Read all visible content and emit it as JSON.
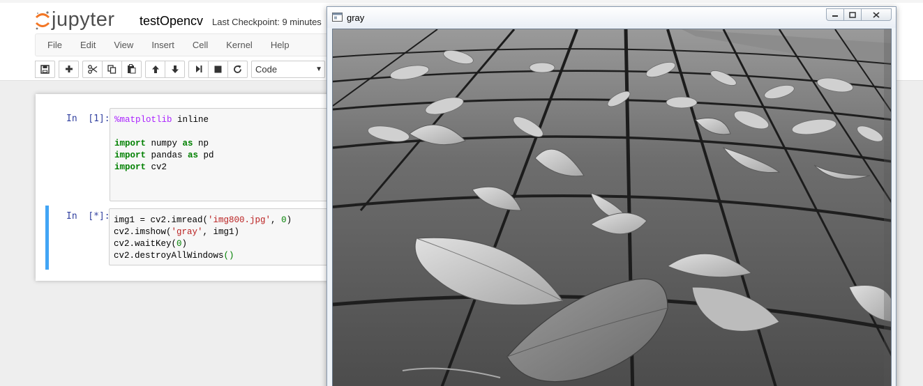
{
  "app": {
    "logo_text": "jupyter",
    "notebook_name": "testOpencv",
    "checkpoint": "Last Checkpoint: 9 minutes"
  },
  "menu": [
    "File",
    "Edit",
    "View",
    "Insert",
    "Cell",
    "Kernel",
    "Help"
  ],
  "toolbar": {
    "cell_type": "Code",
    "icons": [
      "save-icon",
      "plus-icon",
      "cut-icon",
      "copy-icon",
      "paste-icon",
      "arrow-up-icon",
      "arrow-down-icon",
      "run-step-icon",
      "stop-icon",
      "restart-icon"
    ]
  },
  "cells": [
    {
      "prompt": "In  [1]:",
      "lines": [
        [
          {
            "t": "%matplotlib",
            "c": "mg"
          },
          {
            "t": " inline",
            "c": ""
          }
        ],
        [],
        [
          {
            "t": "import",
            "c": "kw"
          },
          {
            "t": " numpy ",
            "c": ""
          },
          {
            "t": "as",
            "c": "kw"
          },
          {
            "t": " np",
            "c": ""
          }
        ],
        [
          {
            "t": "import",
            "c": "kw"
          },
          {
            "t": " pandas ",
            "c": ""
          },
          {
            "t": "as",
            "c": "kw"
          },
          {
            "t": " pd",
            "c": ""
          }
        ],
        [
          {
            "t": "import",
            "c": "kw"
          },
          {
            "t": " cv2",
            "c": ""
          }
        ]
      ]
    },
    {
      "prompt": "In  [*]:",
      "lines": [
        [
          {
            "t": "img1 = cv2.imread(",
            "c": ""
          },
          {
            "t": "'img800.jpg'",
            "c": "str"
          },
          {
            "t": ", ",
            "c": ""
          },
          {
            "t": "0",
            "c": "num"
          },
          {
            "t": ")",
            "c": ""
          }
        ],
        [
          {
            "t": "cv2.imshow(",
            "c": ""
          },
          {
            "t": "'gray'",
            "c": "str"
          },
          {
            "t": ", img1)",
            "c": ""
          }
        ],
        [
          {
            "t": "cv2.waitKey(",
            "c": ""
          },
          {
            "t": "0",
            "c": "num"
          },
          {
            "t": ")",
            "c": ""
          }
        ],
        [
          {
            "t": "cv2.destroyAllWindows",
            "c": ""
          },
          {
            "t": "()",
            "c": "paren"
          }
        ]
      ]
    }
  ],
  "cv_window": {
    "title": "gray"
  },
  "colors": {
    "active_cell_border": "#42a5f5",
    "prompt": "#303f9f",
    "keyword": "#008000",
    "magic": "#aa22ff",
    "string": "#ba2121"
  }
}
